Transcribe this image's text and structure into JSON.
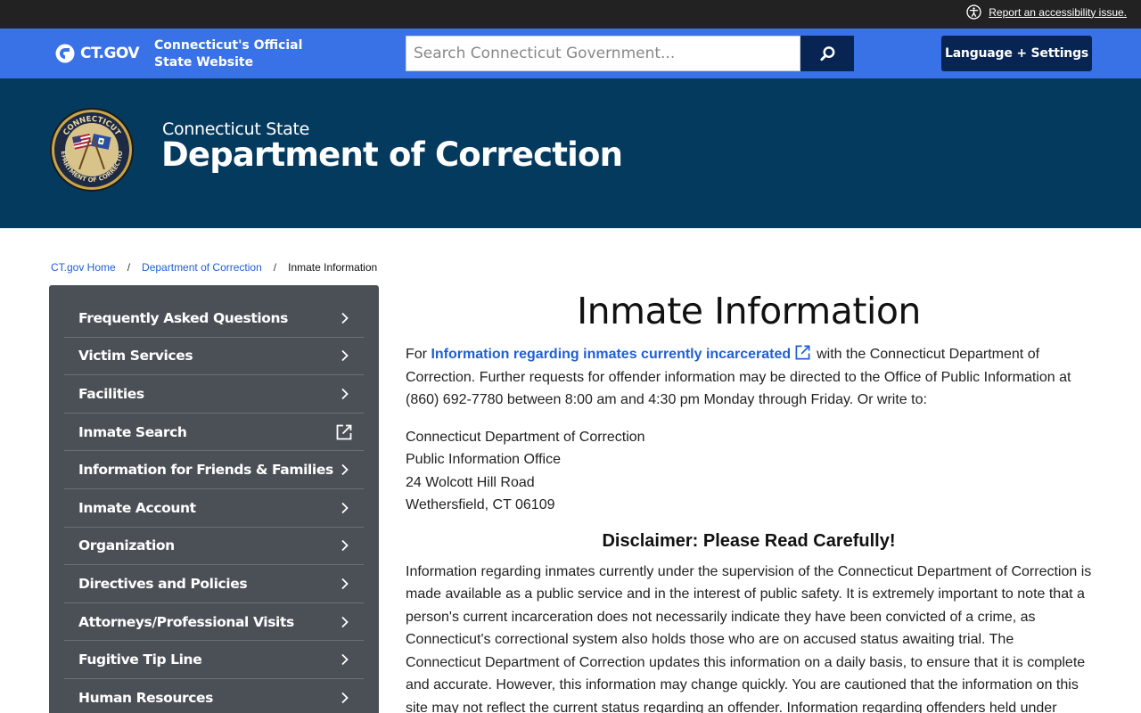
{
  "utility_bar": {
    "accessibility_link": "Report an accessibility issue."
  },
  "ctgov_bar": {
    "logo_text": "CT.GOV",
    "tagline": "Connecticut's Official State Website",
    "search_placeholder": "Search Connecticut Government...",
    "language_button": "Language + Settings"
  },
  "agency": {
    "subtitle": "Connecticut State",
    "title": "Department of Correction",
    "seal_text_top": "CONNECTICUT",
    "seal_text_bottom": "DEPARTMENT OF CORRECTION"
  },
  "breadcrumb": {
    "items": [
      "CT.gov Home",
      "Department of Correction"
    ],
    "separator": "/",
    "current": "Inmate Information"
  },
  "sidebar": {
    "items": [
      {
        "label": "Frequently Asked Questions",
        "icon": "chevron-right-icon"
      },
      {
        "label": "Victim Services",
        "icon": "chevron-right-icon"
      },
      {
        "label": "Facilities",
        "icon": "chevron-right-icon"
      },
      {
        "label": "Inmate Search",
        "icon": "external-link-icon"
      },
      {
        "label": "Information for Friends & Families",
        "icon": "chevron-right-icon"
      },
      {
        "label": "Inmate Account",
        "icon": "chevron-right-icon"
      },
      {
        "label": "Organization",
        "icon": "chevron-right-icon"
      },
      {
        "label": "Directives and Policies",
        "icon": "chevron-right-icon"
      },
      {
        "label": "Attorneys/Professional Visits",
        "icon": "chevron-right-icon"
      },
      {
        "label": "Fugitive Tip Line",
        "icon": "chevron-right-icon"
      },
      {
        "label": "Human Resources",
        "icon": "chevron-right-icon"
      }
    ]
  },
  "main": {
    "title": "Inmate Information",
    "intro_prefix": "For",
    "intro_link": "Information regarding inmates currently incarcerated",
    "intro_suffix": "with the Connecticut Department of Correction. Further requests for offender information may be directed to the Office of Public Information at (860) 692-7780 between 8:00 am and 4:30 pm Monday through Friday.  Or write to:",
    "address": [
      "Connecticut Department of Correction",
      "Public Information Office",
      "24 Wolcott Hill Road",
      "Wethersfield, CT 06109"
    ],
    "disclaimer_heading": "Disclaimer: Please Read Carefully!",
    "disclaimer_text": "Information regarding inmates currently under the supervision of the Connecticut Department of Correction is made available as a public service and in the interest of public safety. It is extremely important to note that a person's current incarceration does not necessarily indicate they have been convicted of a crime, as Connecticut's correctional system also holds those who are on accused status awaiting trial. The Connecticut Department of Correction updates this information on a daily basis, to ensure that it is complete and accurate. However, this information may change quickly. You are cautioned that the information on this site may not reflect the current status regarding an offender. Information regarding offenders held under"
  },
  "colors": {
    "utility_bar": "#222222",
    "ctgov_bar": "#3872e6",
    "agency_header": "#053a5f",
    "dark_button": "#072453",
    "sidebar": "#4b5057",
    "link": "#1f5fd6"
  }
}
